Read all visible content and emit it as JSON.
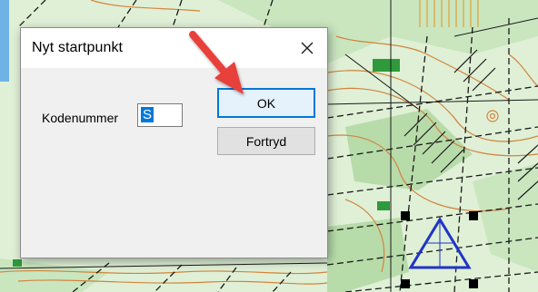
{
  "dialog": {
    "title": "Nyt startpunkt",
    "close_icon": "close-icon",
    "field_label": "Kodenummer",
    "field_value": "S",
    "ok_label": "OK",
    "cancel_label": "Fortryd"
  },
  "colors": {
    "map_background": "#ffffff",
    "map_vegetation": "#c9e6bf",
    "map_vegetation_dark": "#8fcf83",
    "map_contour": "#d2843c",
    "map_paths": "#1a1a1a",
    "start_triangle": "#2033c8",
    "annotation_arrow": "#e8413b",
    "selection_blue": "#0078d7"
  }
}
